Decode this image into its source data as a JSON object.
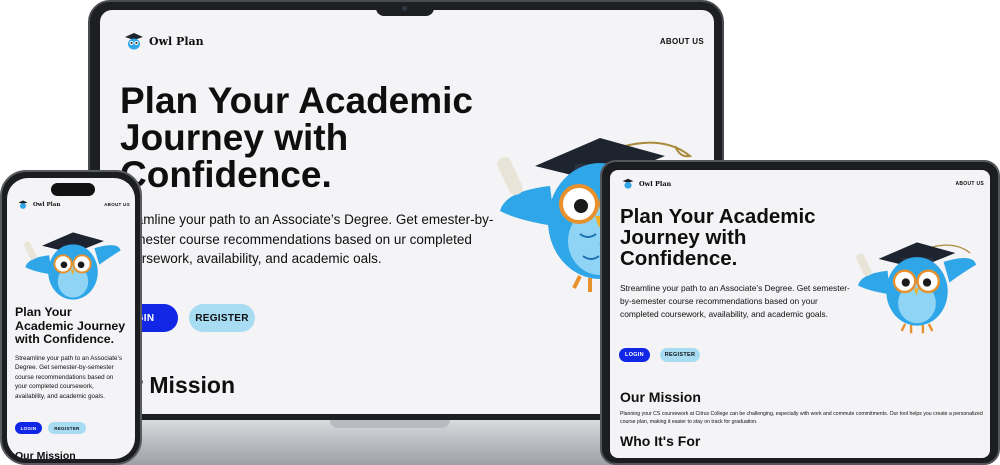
{
  "brand": {
    "name": "Owl Plan"
  },
  "nav": {
    "about": "ABOUT US"
  },
  "hero": {
    "laptop_title": "Plan Your Academic Journey with Confidence.",
    "laptop_lead": "treamline your path to an Associate’s Degree. Get emester-by-semester course recommendations based on ur completed coursework, availability, and academic oals.",
    "phone_title": "Plan Your Academic Journey with Confidence.",
    "phone_lead": "Streamline your path to an Associate’s Degree. Get semester-by-semester course recommendations based on your completed coursework, availability, and academic goals.",
    "tablet_title": "Plan Your Academic Journey with Confidence.",
    "tablet_lead": "Streamline your path to an Associate’s Degree. Get semester-by-semester course recommendations based on your completed coursework, availability, and academic goals.",
    "login_laptop": "GIN",
    "login": "LOGIN",
    "register": "REGISTER"
  },
  "mission": {
    "laptop_heading": "ur Mission",
    "heading": "Our Mission",
    "text": "Planning your CS coursework at Citrus College can be challenging, especially with work and commute commitments. Our tool helps you create a personalized course plan, making it easier to stay on track for graduation."
  },
  "who": {
    "heading": "Who It's For"
  },
  "colors": {
    "login": "#1227e6",
    "register": "#a8dcf3",
    "owl_body": "#2ea6e8",
    "owl_dark": "#1b6fb0",
    "cap": "#1d2430",
    "tassel": "#a98a3a"
  },
  "icons": {
    "logo": "owl-logo-icon",
    "mascot": "owl-mascot"
  }
}
